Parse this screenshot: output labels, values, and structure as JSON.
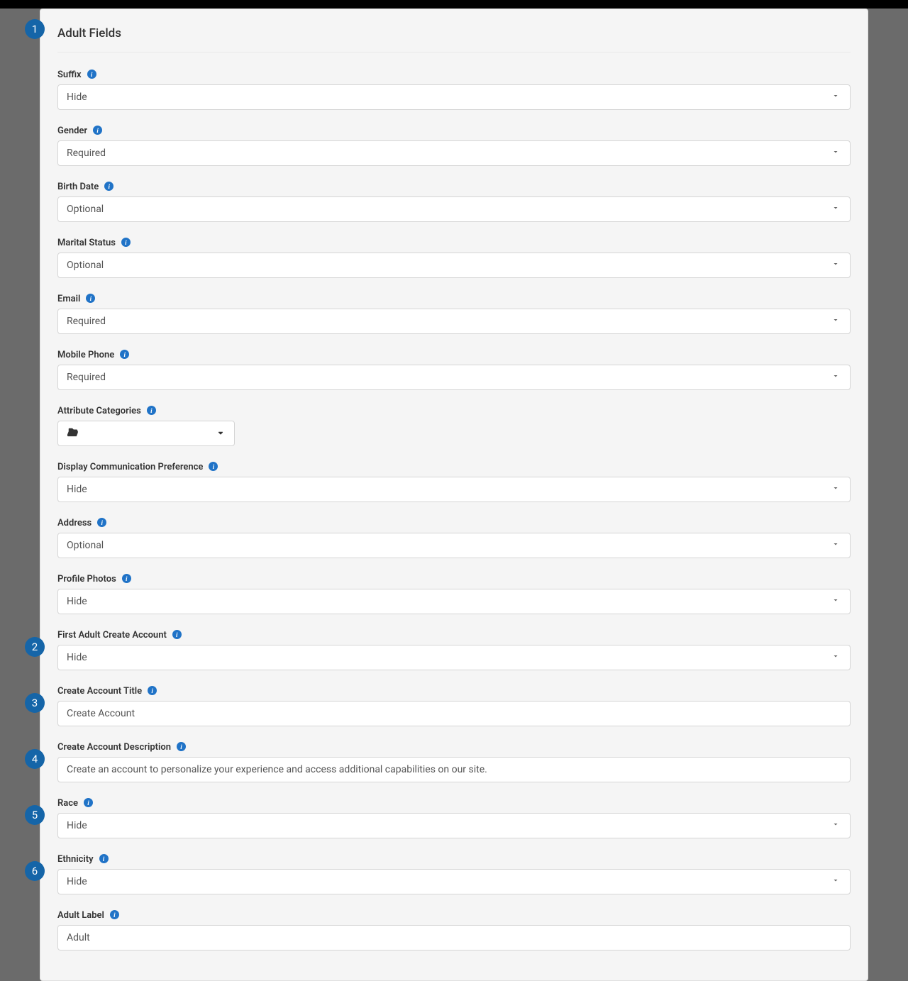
{
  "panel": {
    "title": "Adult Fields"
  },
  "badges": [
    "1",
    "2",
    "3",
    "4",
    "5",
    "6"
  ],
  "fields": {
    "suffix": {
      "label": "Suffix",
      "value": "Hide"
    },
    "gender": {
      "label": "Gender",
      "value": "Required"
    },
    "birthdate": {
      "label": "Birth Date",
      "value": "Optional"
    },
    "marital": {
      "label": "Marital Status",
      "value": "Optional"
    },
    "email": {
      "label": "Email",
      "value": "Required"
    },
    "mobile": {
      "label": "Mobile Phone",
      "value": "Required"
    },
    "attrcat": {
      "label": "Attribute Categories"
    },
    "commpref": {
      "label": "Display Communication Preference",
      "value": "Hide"
    },
    "address": {
      "label": "Address",
      "value": "Optional"
    },
    "photos": {
      "label": "Profile Photos",
      "value": "Hide"
    },
    "firstadult": {
      "label": "First Adult Create Account",
      "value": "Hide"
    },
    "accttitle": {
      "label": "Create Account Title",
      "value": "Create Account"
    },
    "acctdesc": {
      "label": "Create Account Description",
      "value": "Create an account to personalize your experience and access additional capabilities on our site."
    },
    "race": {
      "label": "Race",
      "value": "Hide"
    },
    "ethnicity": {
      "label": "Ethnicity",
      "value": "Hide"
    },
    "adultlabel": {
      "label": "Adult Label",
      "value": "Adult"
    }
  }
}
